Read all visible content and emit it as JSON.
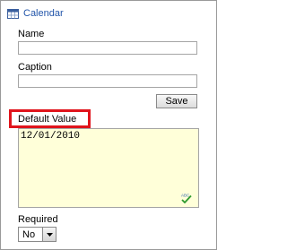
{
  "header": {
    "title": "Calendar",
    "icon": "calendar-icon"
  },
  "fields": {
    "name": {
      "label": "Name",
      "value": ""
    },
    "caption": {
      "label": "Caption",
      "value": ""
    },
    "save_label": "Save",
    "default_value": {
      "label": "Default Value",
      "value": "12/01/2010"
    },
    "required": {
      "label": "Required",
      "selected": "No"
    }
  },
  "colors": {
    "header_link": "#2255aa",
    "highlight_border": "#e0141c",
    "textarea_bg": "#ffffd9"
  },
  "icons": [
    "calendar-icon",
    "spellcheck-icon",
    "dropdown-arrow-icon"
  ]
}
